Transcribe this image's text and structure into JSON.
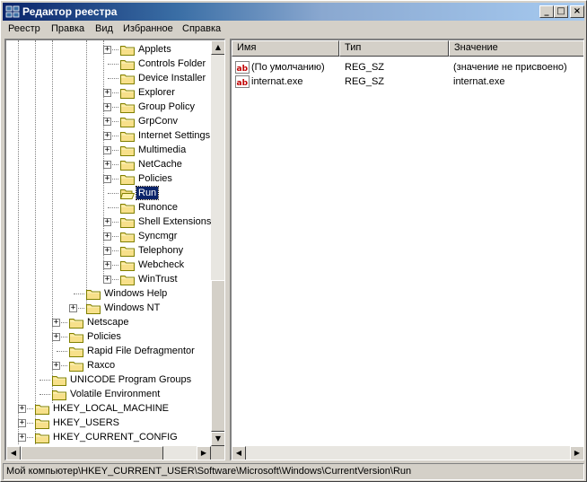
{
  "window": {
    "title": "Редактор реестра",
    "controls": {
      "minimize": "_",
      "maximize": "□",
      "close": "×"
    }
  },
  "menu": [
    "Реестр",
    "Правка",
    "Вид",
    "Избранное",
    "Справка"
  ],
  "tree": [
    {
      "label": "Applets",
      "level": 3,
      "expander": "+"
    },
    {
      "label": "Controls Folder",
      "level": 3,
      "expander": ""
    },
    {
      "label": "Device Installer",
      "level": 3,
      "expander": ""
    },
    {
      "label": "Explorer",
      "level": 3,
      "expander": "+"
    },
    {
      "label": "Group Policy",
      "level": 3,
      "expander": "+"
    },
    {
      "label": "GrpConv",
      "level": 3,
      "expander": "+"
    },
    {
      "label": "Internet Settings",
      "level": 3,
      "expander": "+"
    },
    {
      "label": "Multimedia",
      "level": 3,
      "expander": "+"
    },
    {
      "label": "NetCache",
      "level": 3,
      "expander": "+"
    },
    {
      "label": "Policies",
      "level": 3,
      "expander": "+"
    },
    {
      "label": "Run",
      "level": 3,
      "expander": "",
      "selected": true,
      "open": true
    },
    {
      "label": "Runonce",
      "level": 3,
      "expander": ""
    },
    {
      "label": "Shell Extensions",
      "level": 3,
      "expander": "+"
    },
    {
      "label": "Syncmgr",
      "level": 3,
      "expander": "+"
    },
    {
      "label": "Telephony",
      "level": 3,
      "expander": "+"
    },
    {
      "label": "Webcheck",
      "level": 3,
      "expander": "+"
    },
    {
      "label": "WinTrust",
      "level": 3,
      "expander": "+"
    },
    {
      "label": "Windows Help",
      "level": 2,
      "expander": ""
    },
    {
      "label": "Windows NT",
      "level": 2,
      "expander": "+"
    },
    {
      "label": "Netscape",
      "level": 1,
      "expander": "+"
    },
    {
      "label": "Policies",
      "level": 1,
      "expander": "+"
    },
    {
      "label": "Rapid File Defragmentor",
      "level": 1,
      "expander": ""
    },
    {
      "label": "Raxco",
      "level": 1,
      "expander": "+"
    },
    {
      "label": "UNICODE Program Groups",
      "level": 0,
      "expander": ""
    },
    {
      "label": "Volatile Environment",
      "level": 0,
      "expander": ""
    },
    {
      "label": "HKEY_LOCAL_MACHINE",
      "level": -1,
      "expander": "+"
    },
    {
      "label": "HKEY_USERS",
      "level": -1,
      "expander": "+"
    },
    {
      "label": "HKEY_CURRENT_CONFIG",
      "level": -1,
      "expander": "+"
    }
  ],
  "list": {
    "columns": [
      "Имя",
      "Тип",
      "Значение"
    ],
    "rows": [
      {
        "name": "(По умолчанию)",
        "type": "REG_SZ",
        "value": "(значение не присвоено)",
        "icon": "string-value-icon"
      },
      {
        "name": "internat.exe",
        "type": "REG_SZ",
        "value": "internat.exe",
        "icon": "string-value-icon"
      }
    ]
  },
  "scroll_icons": {
    "up": "▲",
    "down": "▼",
    "left": "◀",
    "right": "▶"
  },
  "status": "Мой компьютер\\HKEY_CURRENT_USER\\Software\\Microsoft\\Windows\\CurrentVersion\\Run",
  "colors": {
    "title_active": "#0a246a",
    "selection": "#0a246a",
    "folder": "#f7e08a"
  }
}
